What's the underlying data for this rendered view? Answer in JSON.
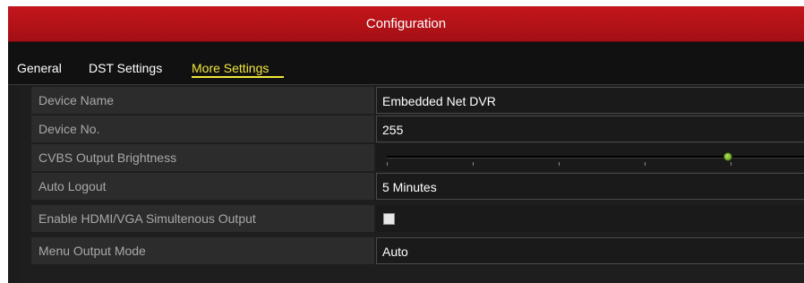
{
  "window": {
    "title": "Configuration"
  },
  "tabs": [
    {
      "label": "General"
    },
    {
      "label": "DST Settings"
    },
    {
      "label": "More Settings",
      "active": true
    }
  ],
  "settings": {
    "device_name": {
      "label": "Device Name",
      "value": "Embedded Net DVR"
    },
    "device_no": {
      "label": "Device No.",
      "value": "255"
    },
    "cvbs_brightness": {
      "label": "CVBS Output Brightness",
      "level_fraction": 0.81
    },
    "auto_logout": {
      "label": "Auto Logout",
      "value": "5 Minutes"
    },
    "hdmi_vga_simultaneous": {
      "label": "Enable HDMI/VGA Simultenous Output",
      "checked": false
    },
    "menu_output_mode": {
      "label": "Menu Output Mode",
      "value": "Auto"
    }
  },
  "colors": {
    "title_bar": "#c4161c",
    "active_tab": "#f2e73a",
    "slider_knob": "#7cc22a"
  }
}
